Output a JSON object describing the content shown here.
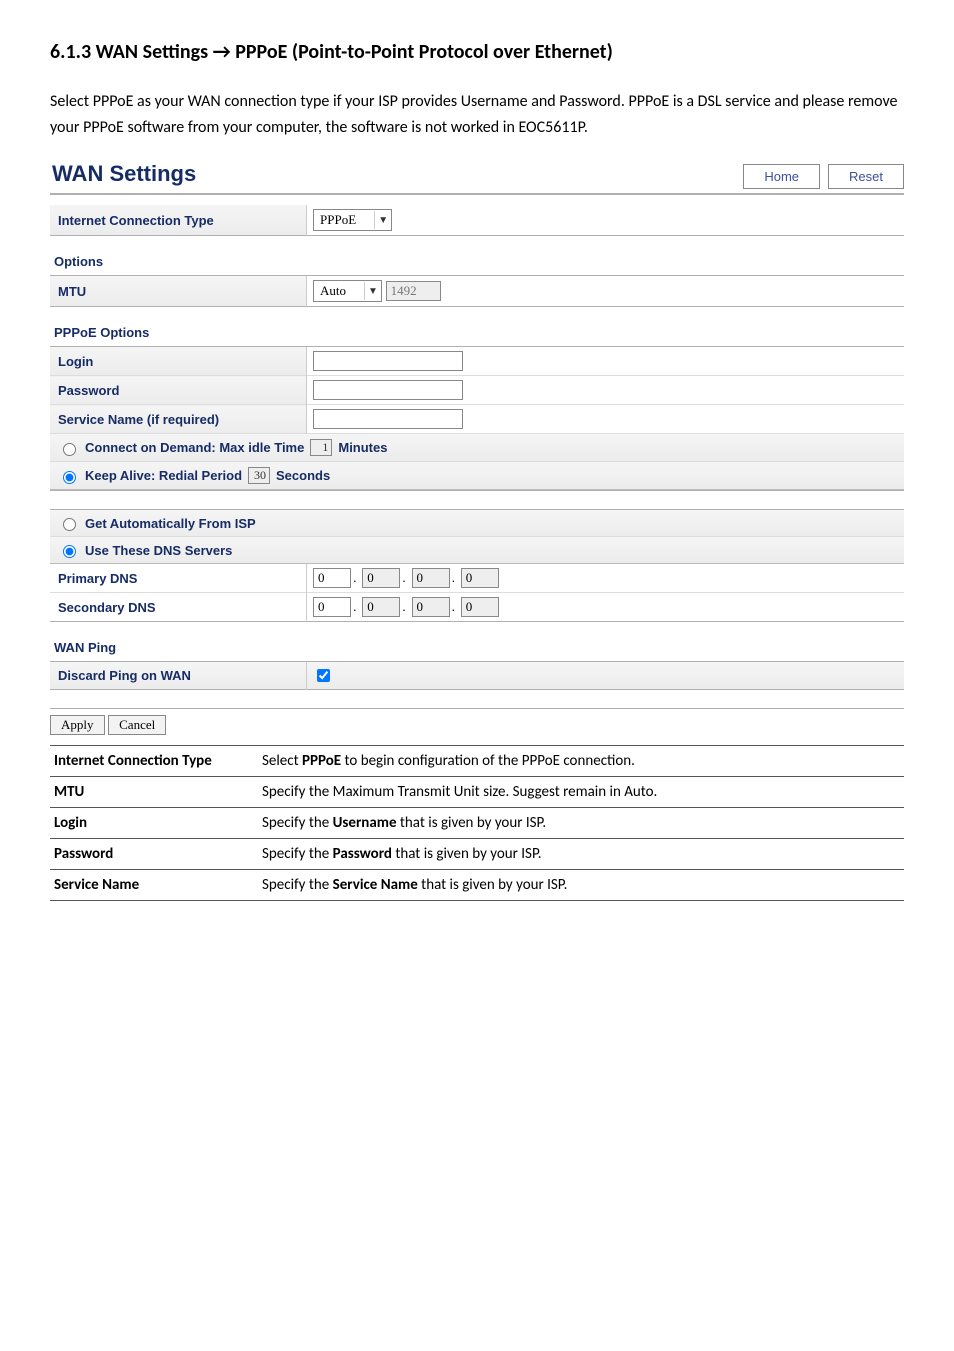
{
  "doc": {
    "heading": "6.1.3 WAN Settings → PPPoE (Point-to-Point Protocol over Ethernet)",
    "intro": "Select PPPoE as your WAN connection type if your ISP provides Username and Password. PPPoE is a DSL service and please remove your PPPoE software from your computer, the software is not worked in EOC5611P."
  },
  "panel": {
    "title": "WAN Settings",
    "home": "Home",
    "reset": "Reset"
  },
  "conn": {
    "label": "Internet Connection Type",
    "value": "PPPoE"
  },
  "options": {
    "heading": "Options"
  },
  "mtu": {
    "label": "MTU",
    "mode": "Auto",
    "value": "1492"
  },
  "pppoe": {
    "heading": "PPPoE Options",
    "login": "Login",
    "password": "Password",
    "service": "Service Name (if required)",
    "connectDemand": "Connect on Demand: Max idle Time",
    "connectDemandVal": "1",
    "minutes": "Minutes",
    "keepAlive": "Keep Alive: Redial Period",
    "keepAliveVal": "30",
    "seconds": "Seconds"
  },
  "dns": {
    "auto": "Get Automatically From ISP",
    "use": "Use These DNS Servers",
    "primary": "Primary DNS",
    "secondary": "Secondary DNS",
    "p": [
      "0",
      "0",
      "0",
      "0"
    ],
    "s": [
      "0",
      "0",
      "0",
      "0"
    ]
  },
  "wanping": {
    "heading": "WAN Ping",
    "discard": "Discard Ping on WAN"
  },
  "buttons": {
    "apply": "Apply",
    "cancel": "Cancel"
  },
  "desc": {
    "rows": [
      {
        "k": "Internet Connection Type",
        "v": "Select <b>PPPoE</b> to begin configuration of the PPPoE connection."
      },
      {
        "k": "MTU",
        "v": "Specify the Maximum Transmit Unit size. Suggest remain in Auto."
      },
      {
        "k": "Login",
        "v": "Specify the <b>Username</b> that is given by your ISP."
      },
      {
        "k": "Password",
        "v": "Specify the <b>Password</b> that is given by your ISP."
      },
      {
        "k": "Service Name",
        "v": "Specify the <b>Service Name</b> that is given by your ISP."
      }
    ]
  }
}
